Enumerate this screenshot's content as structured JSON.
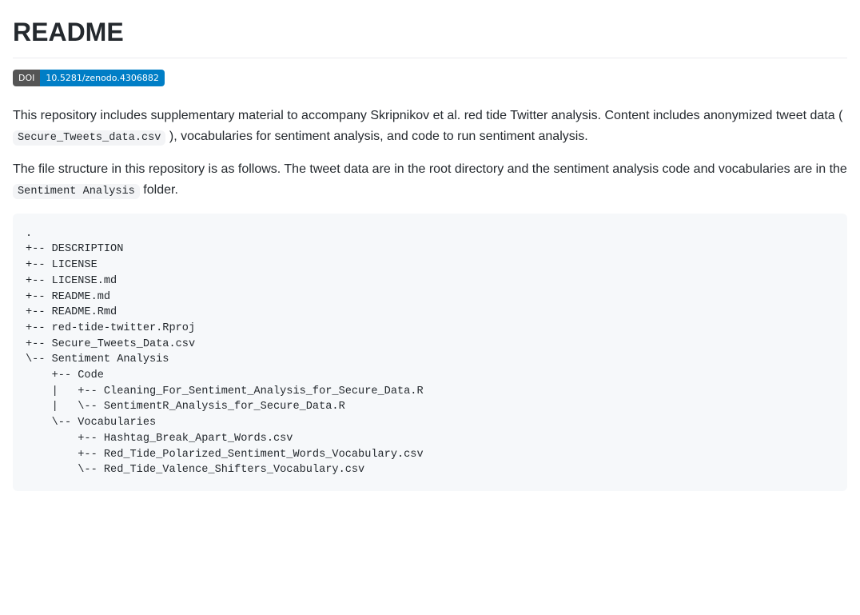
{
  "title": "README",
  "doi": {
    "label": "DOI",
    "value": "10.5281/zenodo.4306882"
  },
  "intro": {
    "part1": "This repository includes supplementary material to accompany Skripnikov et al. red tide Twitter analysis. Content includes anonymized tweet data (",
    "code1": "Secure_Tweets_data.csv",
    "part2": "), vocabularies for sentiment analysis, and code to run sentiment analysis."
  },
  "structure_intro": {
    "part1": "The file structure in this repository is as follows. The tweet data are in the root directory and the sentiment analysis code and vocabularies are in the ",
    "code1": "Sentiment Analysis",
    "part2": " folder."
  },
  "tree": ".\n+-- DESCRIPTION\n+-- LICENSE\n+-- LICENSE.md\n+-- README.md\n+-- README.Rmd\n+-- red-tide-twitter.Rproj\n+-- Secure_Tweets_Data.csv\n\\-- Sentiment Analysis\n    +-- Code\n    |   +-- Cleaning_For_Sentiment_Analysis_for_Secure_Data.R\n    |   \\-- SentimentR_Analysis_for_Secure_Data.R\n    \\-- Vocabularies\n        +-- Hashtag_Break_Apart_Words.csv\n        +-- Red_Tide_Polarized_Sentiment_Words_Vocabulary.csv\n        \\-- Red_Tide_Valence_Shifters_Vocabulary.csv"
}
